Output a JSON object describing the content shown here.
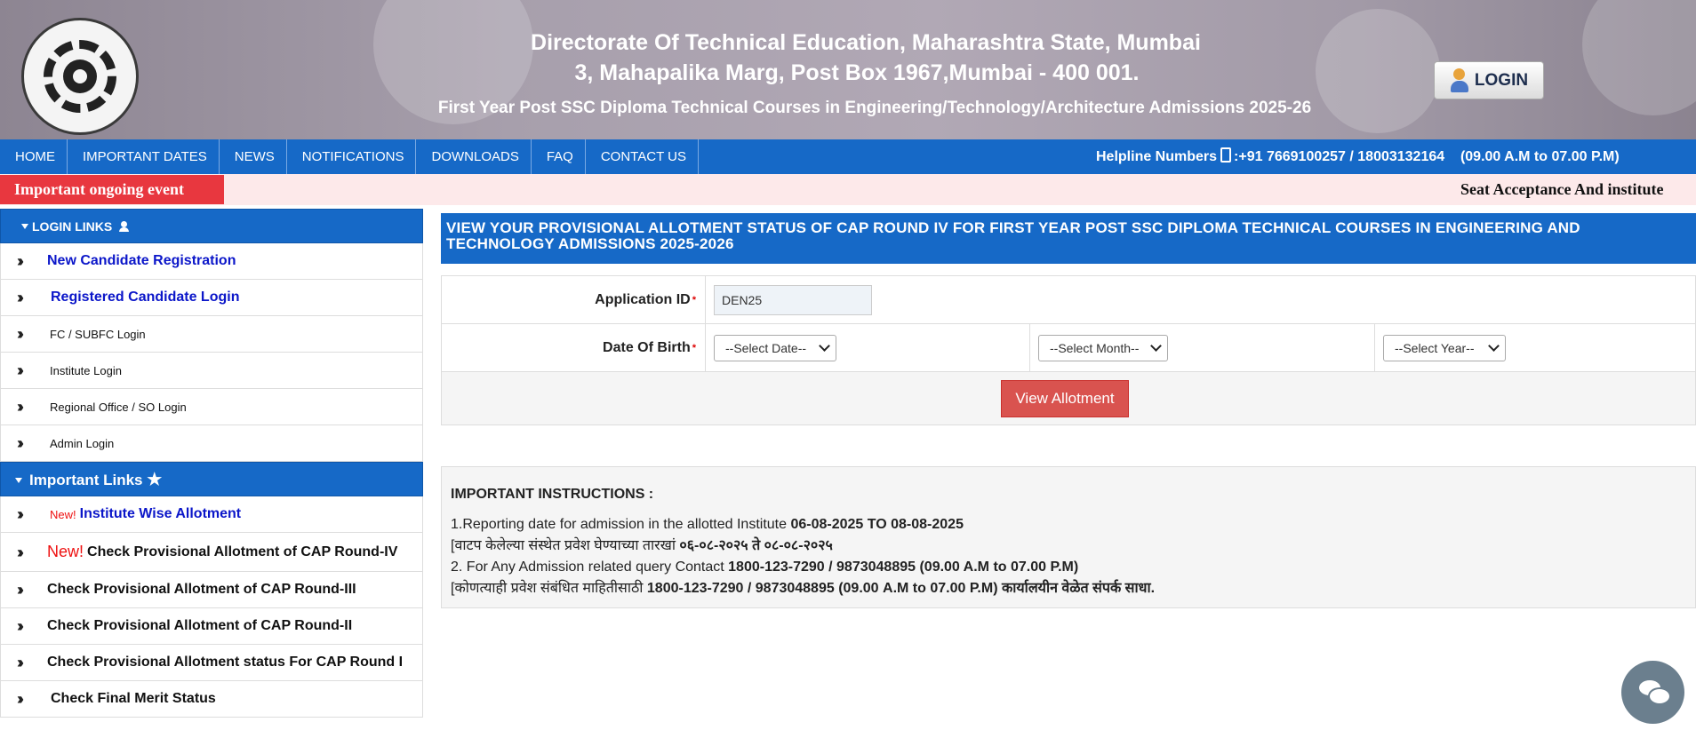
{
  "header": {
    "title_line1": "Directorate Of Technical Education, Maharashtra State, Mumbai",
    "title_line2": "3, Mahapalika Marg, Post Box 1967,Mumbai - 400 001.",
    "subtitle": "First Year Post SSC Diploma Technical Courses in Engineering/Technology/Architecture Admissions 2025-26",
    "login_label": "LOGIN"
  },
  "nav": {
    "items": [
      "HOME",
      "IMPORTANT DATES",
      "NEWS",
      "NOTIFICATIONS",
      "DOWNLOADS",
      "FAQ",
      "CONTACT US"
    ],
    "helpline_label": "Helpline Numbers",
    "helpline_numbers": ":+91 7669100257 / 18003132164",
    "helpline_hours": "(09.00 A.M to 07.00 P.M)"
  },
  "event": {
    "label": "Important ongoing event",
    "ticker": "Seat Acceptance And institute"
  },
  "sidebar": {
    "login_header": "LOGIN LINKS",
    "login_links": [
      "New Candidate Registration",
      "Registered Candidate Login",
      "FC / SUBFC Login",
      "Institute Login",
      "Regional Office / SO Login",
      "Admin Login"
    ],
    "important_header": "Important Links",
    "new_badge": "New!",
    "important_links": [
      "Institute Wise Allotment",
      "Check Provisional Allotment of CAP Round-IV",
      "Check Provisional Allotment of CAP Round-III",
      "Check Provisional Allotment of CAP Round-II",
      "Check Provisional Allotment status For CAP Round I",
      "Check Final Merit Status"
    ]
  },
  "main": {
    "title": "VIEW YOUR PROVISIONAL ALLOTMENT STATUS OF CAP ROUND IV FOR FIRST YEAR POST SSC DIPLOMA TECHNICAL COURSES IN ENGINEERING AND TECHNOLOGY ADMISSIONS 2025-2026",
    "app_id_label": "Application ID",
    "app_id_value": "DEN25",
    "dob_label": "Date Of Birth",
    "select_date": "--Select Date--",
    "select_month": "--Select Month--",
    "select_year": "--Select Year--",
    "required_mark": "*",
    "view_button": "View Allotment"
  },
  "instructions": {
    "heading": "IMPORTANT INSTRUCTIONS :",
    "l1_text": "1.Reporting date for admission in the allotted Institute ",
    "l1_bold": "06-08-2025 TO 08-08-2025",
    "l2_text": "[वाटप केलेल्या संस्थेत प्रवेश घेण्याच्या तारखां ",
    "l2_bold": "०६-०८-२०२५ ते ०८-०८-२०२५",
    "l3_text": "2. For Any Admission related query Contact ",
    "l3_bold": "1800-123-7290 / 9873048895 (09.00 A.M to 07.00 P.M)",
    "l4_text": "[कोणत्याही प्रवेश संबंधित माहितीसाठी ",
    "l4_bold": "1800-123-7290 / 9873048895 (09.00 A.M to 07.00 P.M) कार्यालयीन वेळेत संपर्क साधा."
  }
}
